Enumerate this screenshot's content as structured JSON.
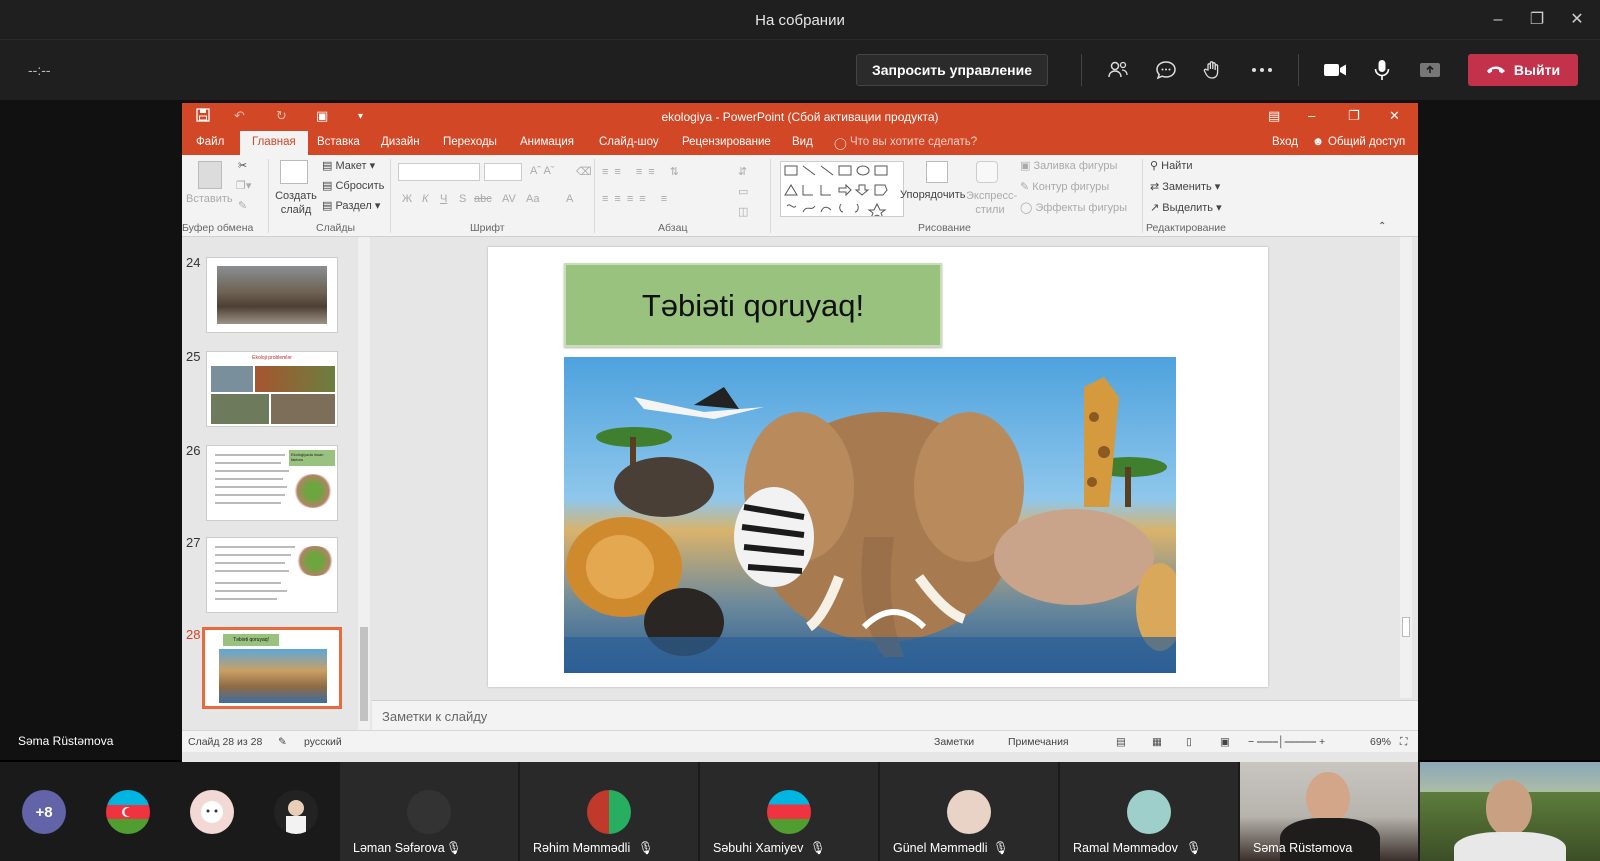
{
  "window": {
    "title": "На собрании"
  },
  "meeting": {
    "timer": "--:--",
    "request_control": "Запросить управление",
    "leave": "Выйти"
  },
  "presenter": "Səma Rüstəmova",
  "ppt": {
    "title": "ekologiya - PowerPoint (Сбой активации продукта)",
    "tabs": [
      "Файл",
      "Главная",
      "Вставка",
      "Дизайн",
      "Переходы",
      "Анимация",
      "Слайд-шоу",
      "Рецензирование",
      "Вид"
    ],
    "tell_me": "Что вы хотите сделать?",
    "signin": "Вход",
    "share": "Общий доступ",
    "ribbon": {
      "paste": "Вставить",
      "new_slide": "Создать слайд",
      "layout": "Макет",
      "reset": "Сбросить",
      "section": "Раздел",
      "arrange": "Упорядочить",
      "quick_styles": "Экспресс-стили",
      "shape_fill": "Заливка фигуры",
      "shape_outline": "Контур фигуры",
      "shape_effects": "Эффекты фигуры",
      "find": "Найти",
      "replace": "Заменить",
      "select": "Выделить",
      "groups": {
        "clipboard": "Буфер обмена",
        "slides": "Слайды",
        "font": "Шрифт",
        "paragraph": "Абзац",
        "drawing": "Рисование",
        "editing": "Редактирование"
      },
      "font_buttons": [
        "Ж",
        "К",
        "Ч",
        "S",
        "abc",
        "AV",
        "Aa",
        "A"
      ]
    },
    "thumbnails": [
      {
        "num": "24"
      },
      {
        "num": "25",
        "title": "Ekoloji problemlər"
      },
      {
        "num": "26",
        "title": "Ekologiyada insan faktoru"
      },
      {
        "num": "27"
      },
      {
        "num": "28",
        "title": "Təbiəti qoruyaq!"
      }
    ],
    "slide_title": "Təbiəti qoruyaq!",
    "notes_placeholder": "Заметки к слайду",
    "status": {
      "slide_of": "Слайд 28 из 28",
      "language": "русский",
      "notes": "Заметки",
      "comments": "Примечания",
      "zoom": "69%"
    }
  },
  "participants": {
    "overflow": "+8",
    "tiles": [
      "Ləman Səfərova",
      "Rəhim Məmmədli",
      "Səbuhi Xamiyev",
      "Günel Məmmədli",
      "Ramal Məmmədov",
      "Səma Rüstəmova"
    ]
  },
  "colors": {
    "teams_bg": "#1f1f1f",
    "leave_red": "#c4314b",
    "ppt_orange": "#d24726",
    "slide_title_green": "#98c27e"
  }
}
